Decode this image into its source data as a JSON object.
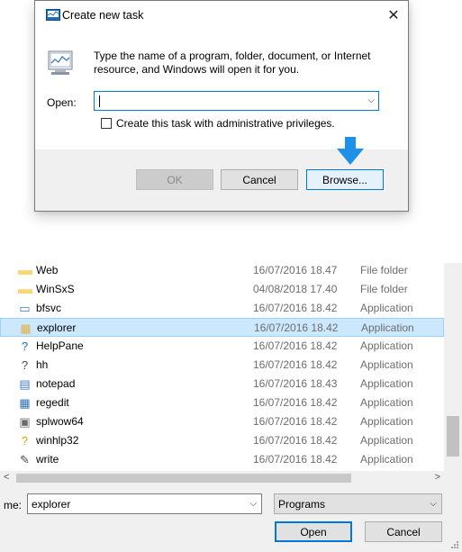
{
  "dialog": {
    "title": "Create new task",
    "description": "Type the name of a program, folder, document, or Internet resource, and Windows will open it for you.",
    "open_label": "Open:",
    "open_value": "",
    "admin_checkbox_label": "Create this task with administrative privileges.",
    "admin_checked": false,
    "buttons": {
      "ok": "OK",
      "cancel": "Cancel",
      "browse": "Browse..."
    }
  },
  "files": [
    {
      "name": "Web",
      "date": "16/07/2016 18.47",
      "type": "File folder",
      "icon": "folder-icon",
      "selected": false
    },
    {
      "name": "WinSxS",
      "date": "04/08/2018 17.40",
      "type": "File folder",
      "icon": "folder-icon",
      "selected": false
    },
    {
      "name": "bfsvc",
      "date": "16/07/2016 18.42",
      "type": "Application",
      "icon": "app-window-icon",
      "selected": false
    },
    {
      "name": "explorer",
      "date": "16/07/2016 18.42",
      "type": "Application",
      "icon": "explorer-icon",
      "selected": true
    },
    {
      "name": "HelpPane",
      "date": "16/07/2016 18.42",
      "type": "Application",
      "icon": "help-icon",
      "selected": false
    },
    {
      "name": "hh",
      "date": "16/07/2016 18.42",
      "type": "Application",
      "icon": "help-file-icon",
      "selected": false
    },
    {
      "name": "notepad",
      "date": "16/07/2016 18.43",
      "type": "Application",
      "icon": "notepad-icon",
      "selected": false
    },
    {
      "name": "regedit",
      "date": "16/07/2016 18.42",
      "type": "Application",
      "icon": "registry-icon",
      "selected": false
    },
    {
      "name": "splwow64",
      "date": "16/07/2016 18.42",
      "type": "Application",
      "icon": "printer-icon",
      "selected": false
    },
    {
      "name": "winhlp32",
      "date": "16/07/2016 18.42",
      "type": "Application",
      "icon": "help-question-icon",
      "selected": false
    },
    {
      "name": "write",
      "date": "16/07/2016 18.42",
      "type": "Application",
      "icon": "wordpad-icon",
      "selected": false
    }
  ],
  "bottom": {
    "filename_label": "me:",
    "filename_value": "explorer",
    "filetype_value": "Programs",
    "open_button": "Open",
    "cancel_button": "Cancel"
  },
  "colors": {
    "accent": "#0078d7",
    "selection": "#cce8ff",
    "arrow": "#1e90e8",
    "folder": "#f8d775"
  }
}
